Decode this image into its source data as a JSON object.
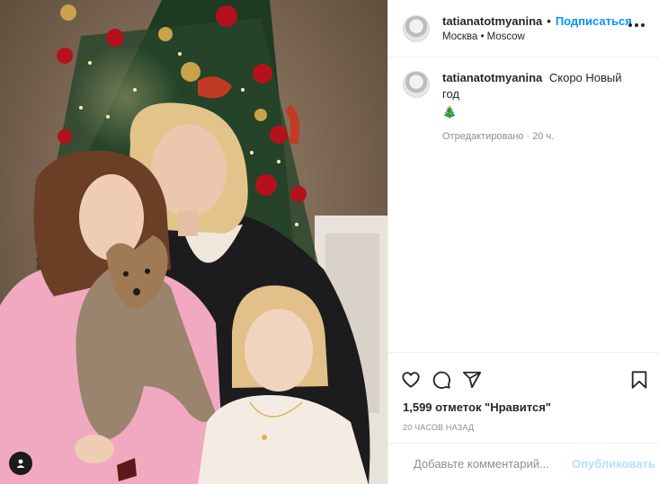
{
  "post": {
    "username": "tatianatotmyanina",
    "separator": "•",
    "follow_label": "Подписаться",
    "location": "Москва • Moscow",
    "caption_text": "Скоро Новый год",
    "caption_emoji": "🎄",
    "edited_label": "Отредактировано",
    "edited_sep": "·",
    "edited_time": "20 ч.",
    "likes": "1,599 отметок \"Нравится\"",
    "posted_time": "20 ЧАСОВ НАЗАД"
  },
  "comment": {
    "placeholder": "Добавьте комментарий...",
    "publish_label": "Опубликовать"
  },
  "icons": {
    "more": "more-options-icon",
    "like": "heart-icon",
    "comment": "comment-icon",
    "share": "share-icon",
    "save": "bookmark-icon",
    "emoji": "smiley-icon",
    "tag": "user-tag-icon"
  },
  "colors": {
    "accent": "#0095f6",
    "publish_disabled": "#b2dffc",
    "muted": "#8e8e8e"
  }
}
